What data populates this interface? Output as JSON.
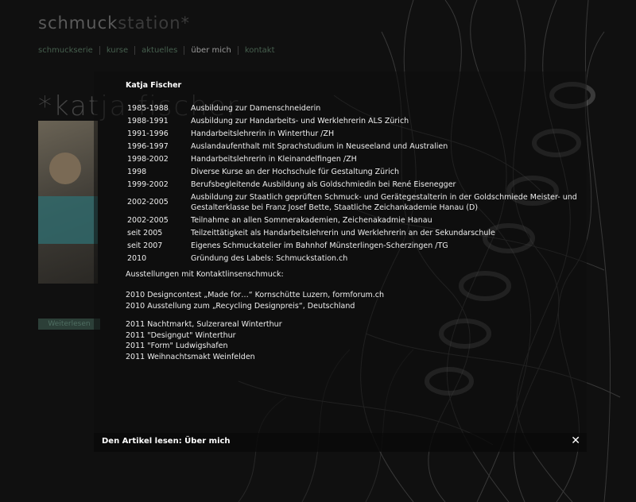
{
  "site": {
    "logo_part1": "schmuck",
    "logo_part2": "station*"
  },
  "nav": {
    "items": [
      {
        "label": "schmuckserie"
      },
      {
        "label": "kurse"
      },
      {
        "label": "aktuelles"
      },
      {
        "label": "über mich"
      },
      {
        "label": "kontakt"
      }
    ]
  },
  "background": {
    "title": "*katja fischer",
    "button_label": "Weiterlesen"
  },
  "article": {
    "name": "Katja Fischer",
    "cv": [
      {
        "year": "1985-1988",
        "text": "Ausbildung zur Damenschneiderin"
      },
      {
        "year": "1988-1991",
        "text": "Ausbildung zur Handarbeits- und Werklehrerin ALS Zürich"
      },
      {
        "year": "1991-1996",
        "text": "Handarbeitslehrerin in Winterthur /ZH"
      },
      {
        "year": "1996-1997",
        "text": "Auslandaufenthalt mit Sprachstudium in Neuseeland und Australien"
      },
      {
        "year": "1998-2002",
        "text": "Handarbeitslehrerin in Kleinandelfingen /ZH"
      },
      {
        "year": "1998",
        "text": "Diverse Kurse an der Hochschule für Gestaltung Zürich"
      },
      {
        "year": "1999-2002",
        "text": "Berufsbegleitende Ausbildung als Goldschmiedin bei René Eisenegger"
      },
      {
        "year": "2002-2005",
        "text": "Ausbildung zur Staatlich geprüften Schmuck- und Gerätegestalterin in der Goldschmiede Meister- und Gestalterklasse bei Franz Josef Bette, Staatliche Zeichankademie Hanau (D)"
      },
      {
        "year": "2002-2005",
        "text": "Teilnahme an allen Sommerakademien, Zeichenakadmie Hanau"
      },
      {
        "year": "seit 2005",
        "text": "Teilzeittätigkeit als Handarbeitslehrerin und Werklehrerin an der Sekundarschule"
      },
      {
        "year": "seit 2007",
        "text": "Eigenes Schmuckatelier im Bahnhof Münsterlingen-Scherzingen /TG"
      },
      {
        "year": "2010",
        "text": "Gründung des Labels: Schmuckstation.ch"
      }
    ],
    "exhibitions_heading": "Ausstellungen mit Kontaktlinsenschmuck:",
    "exhibitions_2010": [
      "2010 Designcontest „Made for…“ Kornschütte Luzern, formforum.ch",
      "2010 Ausstellung zum „Recycling Designpreis“, Deutschland"
    ],
    "exhibitions_2011": [
      "2011 Nachtmarkt, Sulzerareal Winterthur",
      "2011 \"Designgut\" Winterthur",
      "2011 \"Form\" Ludwigshafen",
      "2011 Weihnachtsmakt Weinfelden"
    ]
  },
  "footer": {
    "text": "Den Artikel lesen: Über mich",
    "close_label": "✕"
  }
}
